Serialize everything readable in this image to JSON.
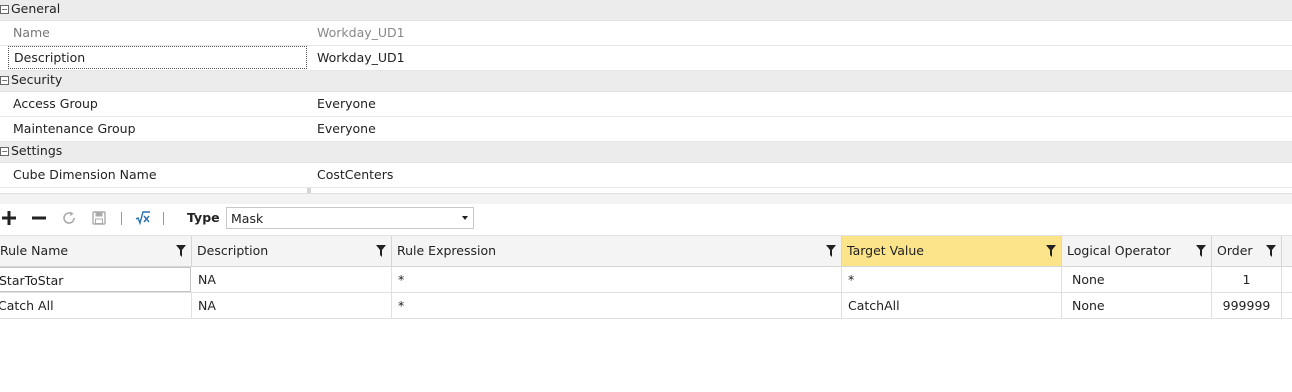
{
  "properties": {
    "general": {
      "label": "General",
      "name_label": "Name",
      "name_value": "Workday_UD1",
      "description_label": "Description",
      "description_value": "Workday_UD1"
    },
    "security": {
      "label": "Security",
      "access_group_label": "Access Group",
      "access_group_value": "Everyone",
      "maintenance_group_label": "Maintenance Group",
      "maintenance_group_value": "Everyone"
    },
    "settings": {
      "label": "Settings",
      "cube_dimension_label": "Cube Dimension Name",
      "cube_dimension_value": "CostCenters"
    },
    "expander_glyph": "−"
  },
  "toolbar": {
    "icons": [
      "plus-icon",
      "minus-icon",
      "refresh-icon",
      "save-icon",
      "formula-icon"
    ],
    "type_label": "Type",
    "type_value": "Mask"
  },
  "grid": {
    "columns": [
      "Rule Name",
      "Description",
      "Rule Expression",
      "Target Value",
      "Logical Operator",
      "Order"
    ],
    "rows": [
      [
        "StarToStar",
        "NA",
        "*",
        "*",
        "None",
        "1"
      ],
      [
        "Catch All",
        "NA",
        "*",
        "CatchAll",
        "None",
        "999999"
      ]
    ],
    "highlight_color": "#fce48a"
  }
}
